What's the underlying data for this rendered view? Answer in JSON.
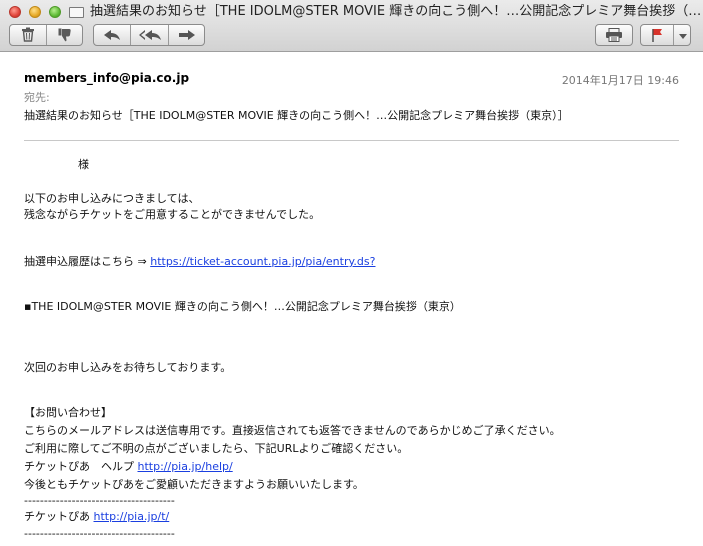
{
  "window": {
    "title": "抽選結果のお知らせ［THE IDOLM@STER MOVIE 輝きの向こう側へ！…公開記念プレミア舞台挨拶（…"
  },
  "toolbar": {
    "delete_icon": "trash-icon",
    "junk_icon": "thumbs-down-icon",
    "reply_icon": "reply-arrow-icon",
    "reply_all_icon": "reply-all-arrow-icon",
    "forward_icon": "forward-arrow-icon",
    "print_icon": "printer-icon",
    "flag_icon": "flag-icon",
    "flag_menu_icon": "chevron-down-icon",
    "flag_color": "#d8332b"
  },
  "header": {
    "from": "members_info@pia.co.jp",
    "date": "2014年1月17日 19:46",
    "to_label": "宛先:",
    "subject": "抽選結果のお知らせ［THE IDOLM@STER MOVIE 輝きの向こう側へ！…公開記念プレミア舞台挨拶（東京）］"
  },
  "body": {
    "salutation": "様",
    "line1": "以下のお申し込みにつきましては、",
    "line2": "残念ながらチケットをご用意することができませんでした。",
    "history_label": "抽選申込履歴はこちら ⇒ ",
    "history_link": "https://ticket-account.pia.jp/pia/entry.ds?",
    "event": "▪THE IDOLM@STER MOVIE 輝きの向こう側へ！…公開記念プレミア舞台挨拶（東京）",
    "closing": "次回のお申し込みをお待ちしております。",
    "contact_heading": "【お問い合わせ】",
    "contact1": "こちらのメールアドレスは送信専用です。直接返信されても返答できませんのであらかじめご了承ください。",
    "contact2": "ご利用に際してご不明の点がございましたら、下記URLよりご確認ください。",
    "help_label": "チケットぴあ　ヘルプ ",
    "help_link": "http://pia.jp/help/",
    "thanks": "今後ともチケットぴあをご愛顧いただきますようお願いいたします。",
    "sep": "--------------------------------------",
    "footer_label": "チケットぴあ ",
    "footer_link": "http://pia.jp/t/",
    "sep2": "--------------------------------------"
  }
}
